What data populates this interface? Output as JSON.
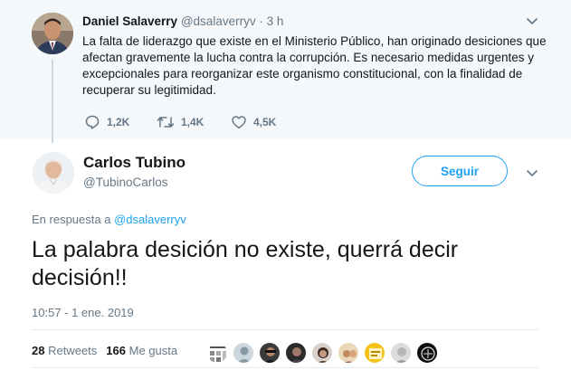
{
  "parent_tweet": {
    "author_name": "Daniel Salaverry",
    "handle": "@dsalaverryv",
    "separator": "·",
    "time": "3 h",
    "text": "La falta de liderazgo que existe en el Ministerio Público, han originado desiciones que afectan gravemente la lucha contra la corrupción. Es necesario medidas urgentes y excepcionales para reorganizar este organismo constitucional, con la finalidad de recuperar su legitimidad.",
    "replies": "1,2K",
    "retweets": "1,4K",
    "likes": "4,5K"
  },
  "main_tweet": {
    "author_name": "Carlos Tubino",
    "handle": "@TubinoCarlos",
    "follow_label": "Seguir",
    "reply_prefix": "En respuesta a",
    "reply_to": "@dsalaverryv",
    "text": "La palabra desición no existe, querrá decir decisión!!",
    "timestamp": "10:57 - 1 ene. 2019",
    "retweets_count": "28",
    "retweets_label": "Retweets",
    "likes_count": "166",
    "likes_label": "Me gusta"
  },
  "colors": {
    "accent": "#1da1f2",
    "secondary_text": "#657786",
    "parent_background": "#f5f8fa"
  },
  "icons": [
    "caret-down-icon",
    "reply-icon",
    "retweet-icon",
    "heart-icon"
  ]
}
